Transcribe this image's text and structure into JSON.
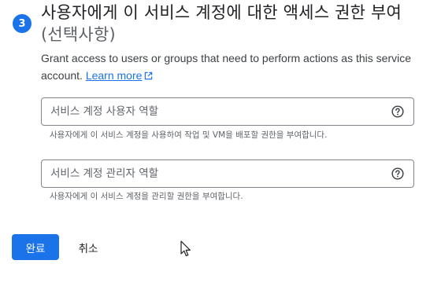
{
  "step": {
    "number": "3",
    "title_main": "사용자에게 이 서비스 계정에 대한 액세스 권한 부여",
    "title_optional": "(선택사항)",
    "description": "Grant access to users or groups that need to perform actions as this service account.",
    "learn_more": "Learn more"
  },
  "fields": {
    "users_role": {
      "placeholder": "서비스 계정 사용자 역할",
      "value": "",
      "hint": "사용자에게 이 서비스 계정을 사용하여 작업 및 VM을 배포할 권한을 부여합니다.",
      "help_icon": "help-circle-icon"
    },
    "admins_role": {
      "placeholder": "서비스 계정 관리자 역할",
      "value": "",
      "hint": "사용자에게 이 서비스 계정을 관리할 권한을 부여합니다.",
      "help_icon": "help-circle-icon"
    }
  },
  "actions": {
    "done": "완료",
    "cancel": "취소"
  },
  "colors": {
    "accent": "#1a73e8",
    "text": "#202124",
    "secondary_text": "#5f6368",
    "border": "#80868b"
  }
}
